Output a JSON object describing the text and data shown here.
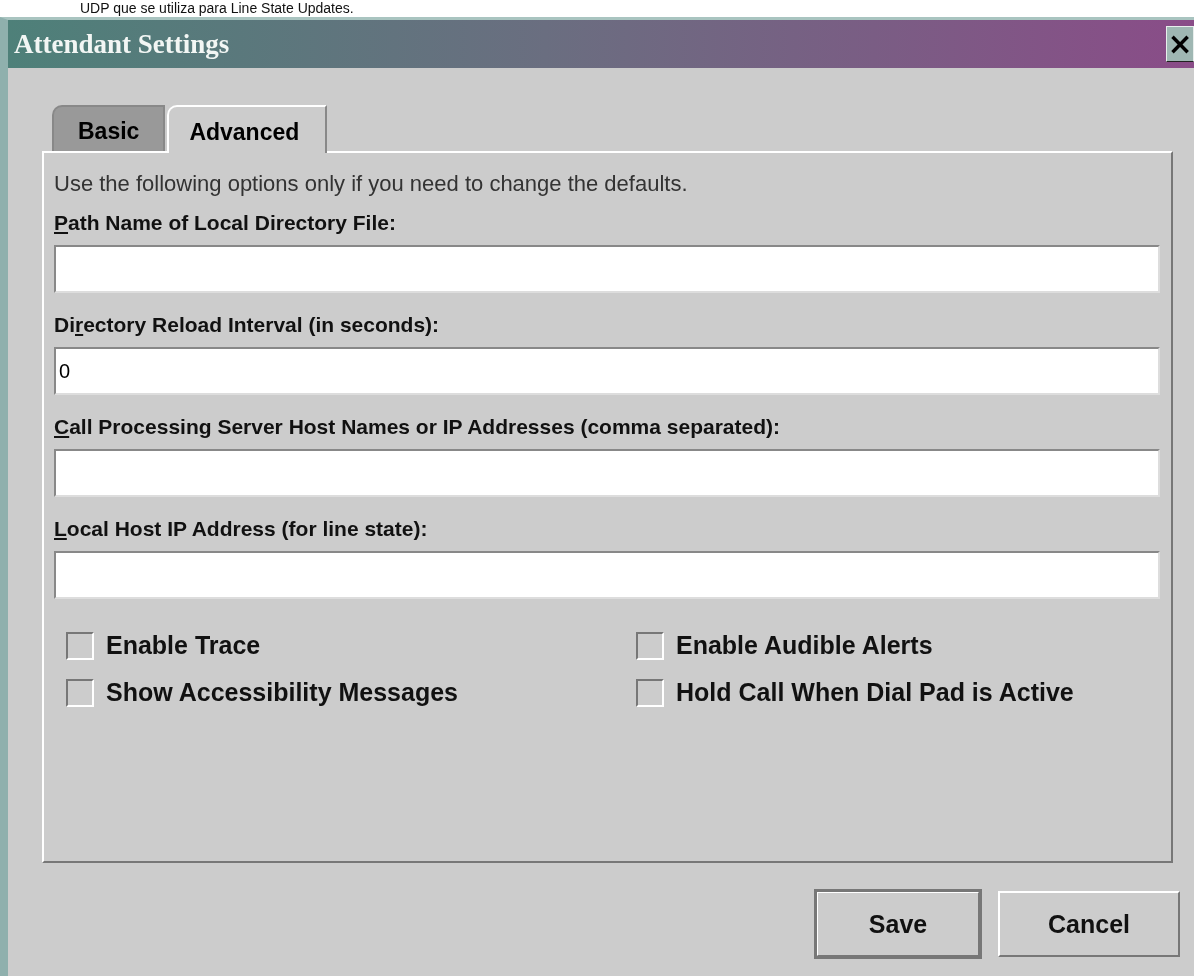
{
  "background_text": "UDP que se utiliza para Line State Updates.",
  "window": {
    "title": "Attendant Settings",
    "close": "×"
  },
  "tabs": [
    {
      "label": "Basic",
      "selected": false
    },
    {
      "label": "Advanced",
      "selected": true
    }
  ],
  "intro": "Use the following options only if you need to change the defaults.",
  "fields": [
    {
      "label": {
        "key": "P",
        "post": "ath Name of Local Directory File:"
      }
    },
    {
      "label": {
        "pre": "Di",
        "key": "r",
        "post": "ectory Reload Interval (in seconds):"
      },
      "value": "0"
    },
    {
      "label": {
        "key": "C",
        "post": "all Processing Server Host Names or IP Addresses (comma separated):"
      }
    },
    {
      "label": {
        "key": "L",
        "post": "ocal Host IP Address (for line state):"
      }
    }
  ],
  "checkboxes": [
    {
      "label": "Enable Trace",
      "checked": false
    },
    {
      "label": "Enable Audible Alerts",
      "checked": false
    },
    {
      "label": "Show Accessibility Messages",
      "checked": false
    },
    {
      "label": "Hold Call When Dial Pad is Active",
      "checked": false
    }
  ],
  "buttons": [
    {
      "label": "Save",
      "default": true
    },
    {
      "label": "Cancel",
      "default": false
    }
  ]
}
